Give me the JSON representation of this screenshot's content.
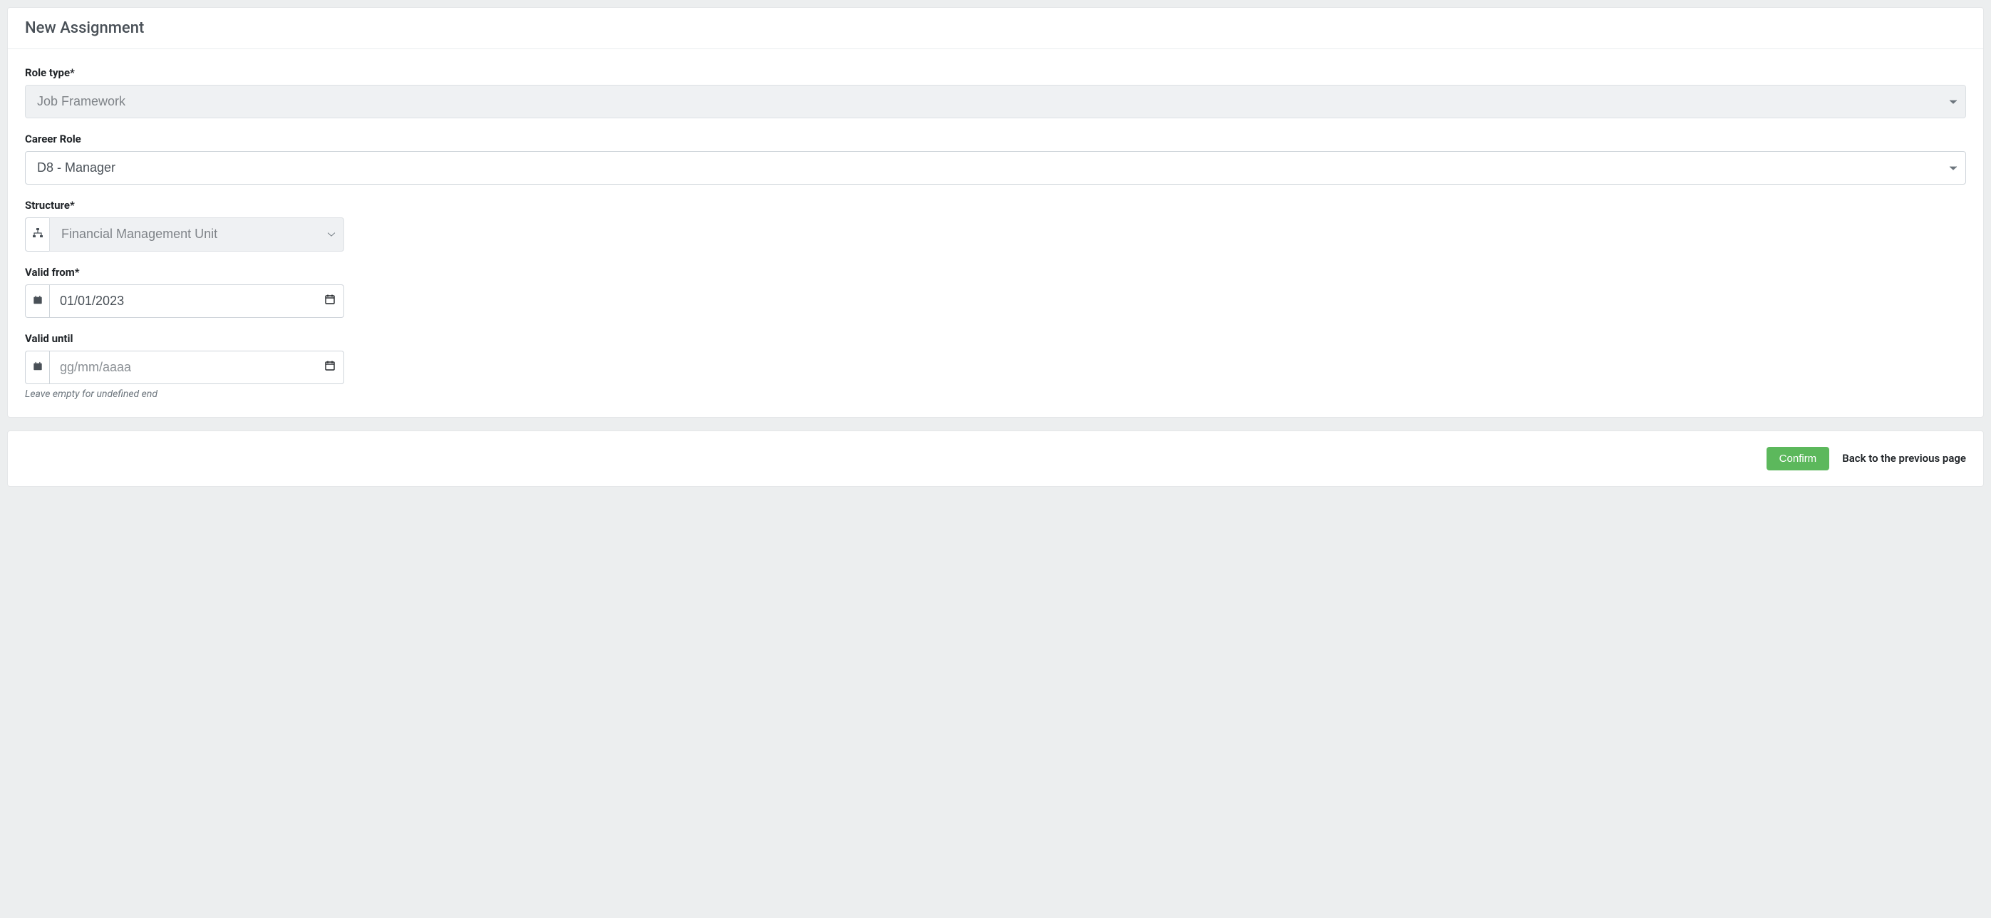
{
  "header": {
    "title": "New Assignment"
  },
  "form": {
    "role_type": {
      "label": "Role type*",
      "value": "Job Framework"
    },
    "career_role": {
      "label": "Career Role",
      "value": "D8 - Manager"
    },
    "structure": {
      "label": "Structure*",
      "value": "Financial Management Unit"
    },
    "valid_from": {
      "label": "Valid from*",
      "value": "01/01/2023"
    },
    "valid_until": {
      "label": "Valid until",
      "placeholder": "gg/mm/aaaa",
      "help": "Leave empty for undefined end"
    }
  },
  "actions": {
    "confirm": "Confirm",
    "back": "Back to the previous page"
  }
}
